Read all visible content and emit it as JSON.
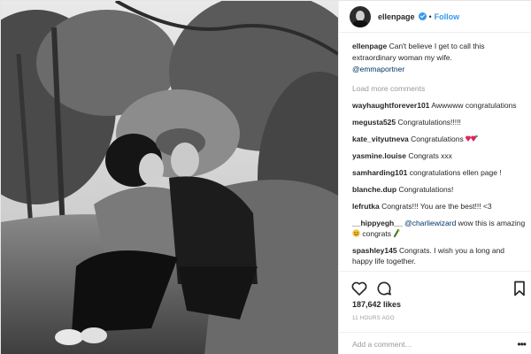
{
  "post": {
    "username": "ellenpage",
    "follow_label": "Follow",
    "dot": "•",
    "caption": {
      "user": "ellenpage",
      "text": "Can't believe I get to call this extraordinary woman my wife.",
      "mention": "@emmaportner"
    },
    "load_more": "Load more comments",
    "comments": [
      {
        "user": "wayhaughtforever101",
        "text": "Awwwww congratulations"
      },
      {
        "user": "megusta525",
        "text": "Congratulations!!!!!"
      },
      {
        "user": "kate_vityutneva",
        "text": "Congratulations"
      },
      {
        "user": "yasmine.louise",
        "text": "Congrats xxx"
      },
      {
        "user": "samharding101",
        "text": "congratulations ellen page !"
      },
      {
        "user": "blanche.dup",
        "text": "Congratulations!"
      },
      {
        "user": "lefrutka",
        "text": "Congrats!!! You are the best!!! <3"
      },
      {
        "user": "__hippyegh__",
        "mention": "@charliewizard",
        "text": "wow this is amazing",
        "text2": "congrats"
      },
      {
        "user": "spashley145",
        "text": "Congrats. I wish you a long and happy life together."
      }
    ],
    "likes": "187,642 likes",
    "time": "11 HOURS AGO",
    "add_comment_placeholder": "Add a comment...",
    "more_label": "•••",
    "colors": {
      "link": "#3897f0",
      "mention": "#003569",
      "muted": "#999999"
    },
    "icons": [
      "verified-icon",
      "heart-icon",
      "comment-icon",
      "bookmark-icon",
      "more-options-icon"
    ]
  }
}
